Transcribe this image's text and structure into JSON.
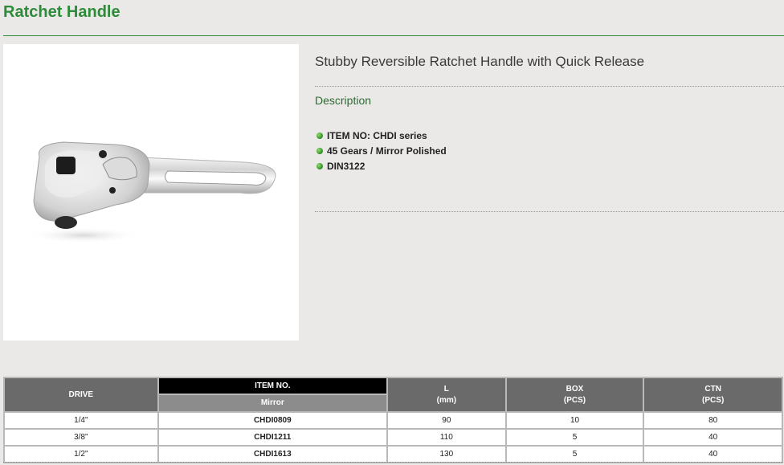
{
  "page": {
    "title": "Ratchet Handle"
  },
  "product": {
    "image_alt": "chrome stubby ratchet handle",
    "name": "Stubby Reversible Ratchet Handle with Quick Release",
    "description_heading": "Description",
    "features": [
      "ITEM NO: CHDI series",
      "45 Gears / Mirror Polished",
      "DIN3122"
    ]
  },
  "spec_table": {
    "headers": {
      "drive": "DRIVE",
      "item_no": "ITEM NO.",
      "item_sub": "Mirror",
      "l": "L",
      "l_unit": "(mm)",
      "box": "BOX",
      "box_unit": "(PCS)",
      "ctn": "CTN",
      "ctn_unit": "(PCS)"
    },
    "rows": [
      {
        "drive": "1/4\"",
        "item": "CHDI0809",
        "l": "90",
        "box": "10",
        "ctn": "80"
      },
      {
        "drive": "3/8\"",
        "item": "CHDI1211",
        "l": "110",
        "box": "5",
        "ctn": "40"
      },
      {
        "drive": "1/2\"",
        "item": "CHDI1613",
        "l": "130",
        "box": "5",
        "ctn": "40"
      }
    ]
  },
  "colors": {
    "accent_green": "#2e8b3a",
    "header_gray": "#6a6a6a",
    "header_black": "#000000"
  }
}
